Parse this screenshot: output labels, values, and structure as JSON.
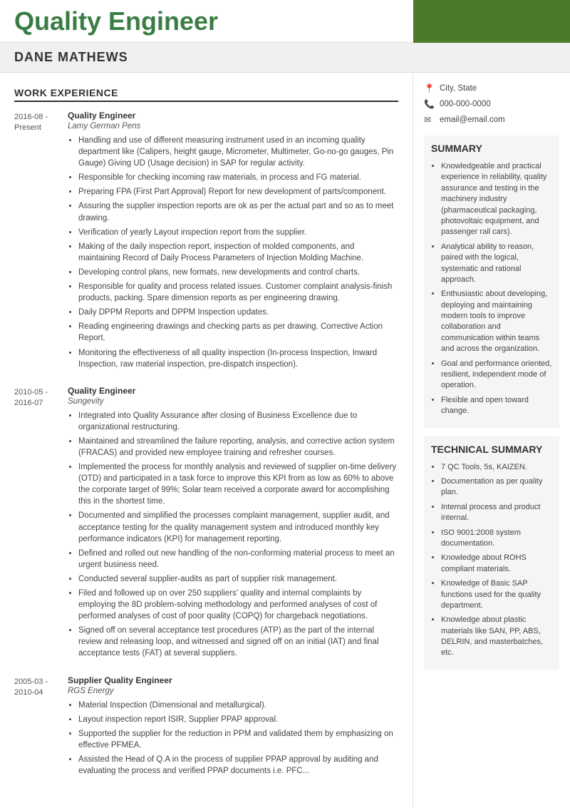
{
  "header": {
    "title": "Quality Engineer",
    "accent_color": "#4a7a2a"
  },
  "name": "DANE MATHEWS",
  "contact": {
    "location": "City, State",
    "phone": "000-000-0000",
    "email": "email@email.com"
  },
  "work_section_label": "WORK EXPERIENCE",
  "jobs": [
    {
      "date_start": "2016-08 -",
      "date_end": "Present",
      "title": "Quality Engineer",
      "company": "Lamy German Pens",
      "bullets": [
        "Handling and use of different measuring instrument used in an incoming quality department like (Calipers, height gauge, Micrometer, Multimeter, Go-no-go gauges, Pin Gauge) Giving UD (Usage decision) in SAP for regular activity.",
        "Responsible for checking incoming raw materials, in process and FG material.",
        "Preparing FPA (First Part Approval) Report for new development of parts/component.",
        "Assuring the supplier inspection reports are ok as per the actual part and so as to meet drawing.",
        "Verification of yearly Layout inspection report from the supplier.",
        "Making of the daily inspection report, inspection of molded components, and maintaining Record of Daily Process Parameters of Injection Molding Machine.",
        "Developing control plans, new formats, new developments and control charts.",
        "Responsible for quality and process related issues. Customer complaint analysis-finish products, packing. Spare dimension reports as per engineering drawing.",
        "Daily DPPM Reports and DPPM Inspection updates.",
        "Reading engineering drawings and checking parts as per drawing. Corrective Action Report.",
        "Monitoring the effectiveness of all quality inspection (In-process Inspection, Inward Inspection, raw material inspection, pre-dispatch inspection)."
      ]
    },
    {
      "date_start": "2010-05 -",
      "date_end": "2016-07",
      "title": "Quality Engineer",
      "company": "Sungevity",
      "bullets": [
        "Integrated into Quality Assurance after closing of Business Excellence due to organizational restructuring.",
        "Maintained and streamlined the failure reporting, analysis, and corrective action system (FRACAS) and provided new employee training and refresher courses.",
        "Implemented the process for monthly analysis and reviewed of supplier on-time delivery (OTD) and participated in a task force to improve this KPI from as low as 60% to above the corporate target of 99%; Solar team received a corporate award for accomplishing this in the shortest time.",
        "Documented and simplified the processes complaint management, supplier audit, and acceptance testing for the quality management system and introduced monthly key performance indicators (KPI) for management reporting.",
        "Defined and rolled out new handling of the non-conforming material process to meet an urgent business need.",
        "Conducted several supplier-audits as part of supplier risk management.",
        "Filed and followed up on over 250 suppliers' quality and internal complaints by employing the 8D problem-solving methodology and performed analyses of cost of performed analyses of cost of poor quality (COPQ) for chargeback negotiations.",
        "Signed off on several acceptance test procedures (ATP) as the part of the internal review and releasing loop, and witnessed and signed off on an initial (IAT) and final acceptance tests (FAT) at several suppliers."
      ]
    },
    {
      "date_start": "2005-03 -",
      "date_end": "2010-04",
      "title": "Supplier Quality Engineer",
      "company": "RGS Energy",
      "bullets": [
        "Material Inspection (Dimensional and metallurgical).",
        "Layout inspection report ISIR, Supplier PPAP approval.",
        "Supported the supplier for the reduction in PPM and validated them by emphasizing on effective PFMEA.",
        "Assisted the Head of Q.A in the process of supplier PPAP approval by auditing and evaluating the process and verified PPAP documents i.e. PFC..."
      ]
    }
  ],
  "summary_section": {
    "title": "SUMMARY",
    "bullets": [
      "Knowledgeable and practical experience in reliability, quality assurance and testing in the machinery industry (pharmaceutical packaging, photovoltaic equipment, and passenger rail cars).",
      "Analytical ability to reason, paired with the logical, systematic and rational approach.",
      "Enthusiastic about developing, deploying and maintaining modern tools to improve collaboration and communication within teams and across the organization.",
      "Goal and performance oriented, resilient, independent mode of operation.",
      "Flexible and open toward change."
    ]
  },
  "technical_section": {
    "title": "TECHNICAL SUMMARY",
    "bullets": [
      "7 QC Tools, 5s, KAIZEN.",
      "Documentation as per quality plan.",
      "Internal process and product internal.",
      "ISO 9001:2008 system documentation.",
      "Knowledge about ROHS compliant materials.",
      "Knowledge of Basic SAP functions used for the quality department.",
      "Knowledge about plastic materials like SAN, PP, ABS, DELRIN, and masterbatches, etc."
    ]
  }
}
